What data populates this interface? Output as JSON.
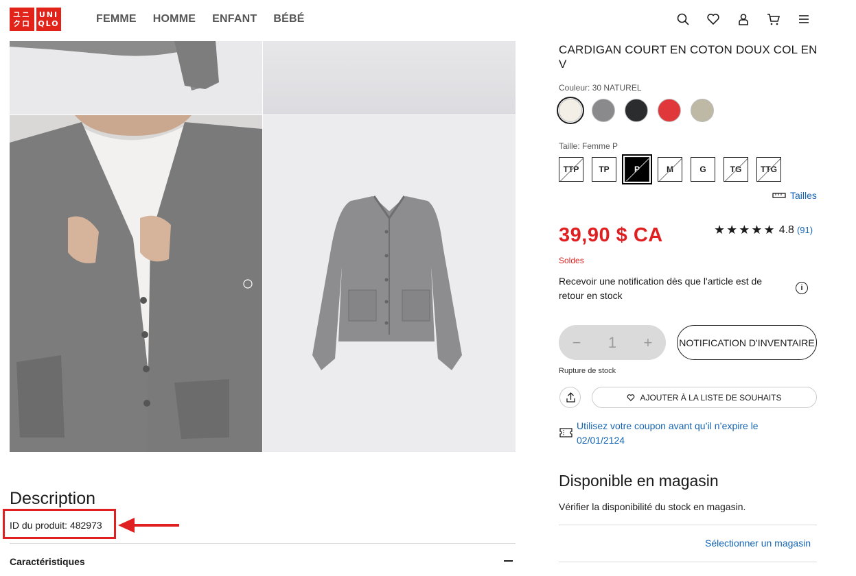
{
  "header": {
    "logo": "UNIQLO",
    "nav": [
      "FEMME",
      "HOMME",
      "ENFANT",
      "BÉBÉ"
    ],
    "icons": [
      "search-icon",
      "heart-icon",
      "user-icon",
      "cart-icon",
      "menu-icon"
    ]
  },
  "product": {
    "title": "CARDIGAN COURT EN COTON DOUX COL EN V",
    "color_label": "Couleur: 30 NATUREL",
    "colors": [
      {
        "name": "naturel",
        "hex": "#f3efe6",
        "selected": true
      },
      {
        "name": "gris",
        "hex": "#8a8a8c",
        "selected": false
      },
      {
        "name": "noir",
        "hex": "#2b2c2e",
        "selected": false
      },
      {
        "name": "rouge",
        "hex": "#e0373b",
        "selected": false
      },
      {
        "name": "beige",
        "hex": "#bdb9a4",
        "selected": false
      }
    ],
    "size_label": "Taille: Femme P",
    "sizes": [
      {
        "label": "TTP",
        "available": false,
        "selected": false
      },
      {
        "label": "TP",
        "available": true,
        "selected": false
      },
      {
        "label": "P",
        "available": false,
        "selected": true
      },
      {
        "label": "M",
        "available": false,
        "selected": false
      },
      {
        "label": "G",
        "available": true,
        "selected": false
      },
      {
        "label": "TG",
        "available": false,
        "selected": false
      },
      {
        "label": "TTG",
        "available": false,
        "selected": false
      }
    ],
    "size_guide": "Tailles",
    "price": "39,90 $ CA",
    "stars": "★★★★★",
    "rating": "4.8",
    "review_count": "(91)",
    "sale_label": "Soldes",
    "notify_text": "Recevoir une notification dès que l'article est de retour en stock",
    "qty": {
      "minus": "−",
      "value": "1",
      "plus": "+"
    },
    "notify_button": "NOTIFICATION D'INVENTAIRE",
    "stock_status": "Rupture de stock",
    "wishlist_button": "AJOUTER À LA LISTE DE SOUHAITS",
    "coupon_text": "Utilisez votre coupon avant qu’il n’expire le 02/01/2124"
  },
  "store": {
    "title": "Disponible en magasin",
    "subtitle": "Vérifier la disponibilité du stock en magasin.",
    "select_link": "Sélectionner un magasin"
  },
  "description": {
    "title": "Description",
    "product_id": "ID du produit: 482973",
    "features": "Caractéristiques"
  },
  "colors": {
    "accent": "#e02020",
    "link": "#1464b4",
    "brand": "#e2231a"
  }
}
